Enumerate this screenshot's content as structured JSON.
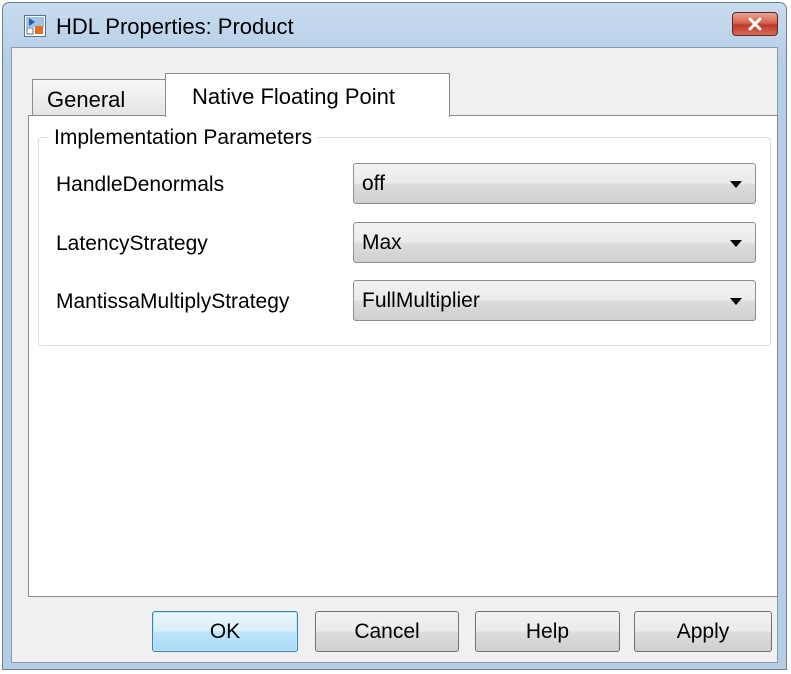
{
  "window": {
    "title": "HDL Properties: Product",
    "close_icon": "close-icon",
    "app_icon": "simulink-block-icon"
  },
  "tabs": [
    {
      "label": "General",
      "active": false
    },
    {
      "label": "Native Floating Point",
      "active": true
    }
  ],
  "group": {
    "title": "Implementation Parameters",
    "params": [
      {
        "label": "HandleDenormals",
        "value": "off"
      },
      {
        "label": "LatencyStrategy",
        "value": "Max"
      },
      {
        "label": "MantissaMultiplyStrategy",
        "value": "FullMultiplier"
      }
    ]
  },
  "buttons": {
    "ok": "OK",
    "cancel": "Cancel",
    "help": "Help",
    "apply": "Apply"
  },
  "colors": {
    "titlebar": "#bcd2ea",
    "close_button": "#c1372a",
    "default_button_border": "#3c7fb1"
  }
}
